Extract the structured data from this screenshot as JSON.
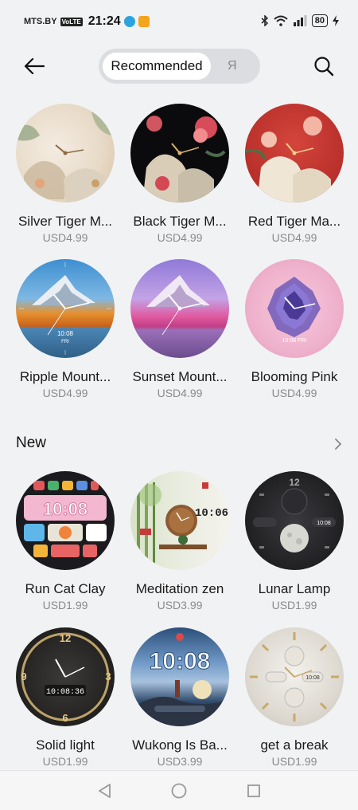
{
  "status_bar": {
    "carrier": "MTS.BY",
    "volte": "VoLTE",
    "time": "21:24",
    "battery": "80"
  },
  "header": {
    "tabs": [
      "Recommended",
      "Я"
    ]
  },
  "recommended": [
    {
      "name": "Silver Tiger M...",
      "price": "USD4.99"
    },
    {
      "name": "Black Tiger M...",
      "price": "USD4.99"
    },
    {
      "name": "Red Tiger Ma...",
      "price": "USD4.99"
    },
    {
      "name": "Ripple Mount...",
      "price": "USD4.99"
    },
    {
      "name": "Sunset Mount...",
      "price": "USD4.99"
    },
    {
      "name": "Blooming Pink",
      "price": "USD4.99"
    }
  ],
  "new_section": {
    "title": "New",
    "items": [
      {
        "name": "Run Cat Clay",
        "price": "USD1.99"
      },
      {
        "name": "Meditation zen",
        "price": "USD3.99"
      },
      {
        "name": "Lunar Lamp",
        "price": "USD1.99"
      },
      {
        "name": "Solid light",
        "price": "USD1.99"
      },
      {
        "name": "Wukong Is Ba...",
        "price": "USD3.99"
      },
      {
        "name": "get a break",
        "price": "USD1.99"
      }
    ]
  },
  "face_texts": {
    "ripple_time": "10:08",
    "ripple_day": "FRI",
    "blooming_time": "10:08 FRI",
    "runcat_digits": "10:08",
    "meditation_time": "10:06",
    "lunar_time": "10:08",
    "solid_time": "10:08:36",
    "wukong_time": "10:08",
    "break_time": "10:08"
  },
  "colors": {
    "background": "#f1f2f4",
    "tab_track": "#dcdde0",
    "price_gray": "#8a8a8a"
  }
}
